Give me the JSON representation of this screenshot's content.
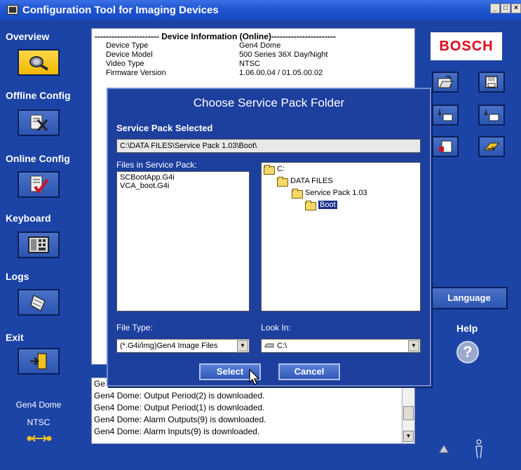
{
  "window": {
    "title": "Configuration Tool for Imaging Devices",
    "buttons": [
      "_",
      "□",
      "×"
    ]
  },
  "sidebar": {
    "sections": [
      {
        "label": "Overview",
        "icon": "magnifier-icon",
        "active": true
      },
      {
        "label": "Offline Config",
        "icon": "offline-config-icon",
        "active": false
      },
      {
        "label": "Online Config",
        "icon": "online-config-icon",
        "active": false
      },
      {
        "label": "Keyboard",
        "icon": "keyboard-icon",
        "active": false
      },
      {
        "label": "Logs",
        "icon": "logs-icon",
        "active": false
      },
      {
        "label": "Exit",
        "icon": "exit-icon",
        "active": false
      }
    ],
    "status_device": "Gen4 Dome",
    "status_video": "NTSC",
    "connection_icon": "connection-arrows-icon"
  },
  "device_info": {
    "header": "----------------------- Device Information (Online)-----------------------",
    "rows": [
      {
        "key": "Device Type",
        "value": "Gen4 Dome"
      },
      {
        "key": "Device Model",
        "value": "500 Series 36X Day/Night"
      },
      {
        "key": "Video Type",
        "value": "NTSC"
      },
      {
        "key": "Firmware Version",
        "value": "1.06.00.04 / 01.05.00.02"
      }
    ]
  },
  "right_panel": {
    "brand": "BOSCH",
    "language_label": "Language",
    "help_label": "Help",
    "help_icon_glyph": "?"
  },
  "dialog": {
    "title": "Choose Service Pack Folder",
    "selected_label": "Service Pack Selected",
    "selected_path": "C:\\DATA FILES\\Service Pack 1.03\\Boot\\",
    "files_label": "Files in Service Pack:",
    "files": [
      "SCBootApp.G4i",
      "VCA_boot.G4i"
    ],
    "tree": [
      {
        "label": "C:",
        "depth": 0,
        "selected": false
      },
      {
        "label": "DATA FILES",
        "depth": 1,
        "selected": false
      },
      {
        "label": "Service Pack 1.03",
        "depth": 2,
        "selected": false
      },
      {
        "label": "Boot",
        "depth": 3,
        "selected": true
      }
    ],
    "file_type_label": "File Type:",
    "file_type_value": "(*.G4i/img)Gen4 Image Files",
    "look_in_label": "Look In:",
    "look_in_value": "C:\\",
    "select_button": "Select",
    "cancel_button": "Cancel"
  },
  "log": {
    "lines": [
      "Ge",
      "Gen4 Dome: Output Period(2) is downloaded.",
      "Gen4 Dome: Output Period(1) is downloaded.",
      "Gen4 Dome: Alarm Outputs(9) is downloaded.",
      "Gen4 Dome: Alarm Inputs(9) is downloaded."
    ]
  }
}
